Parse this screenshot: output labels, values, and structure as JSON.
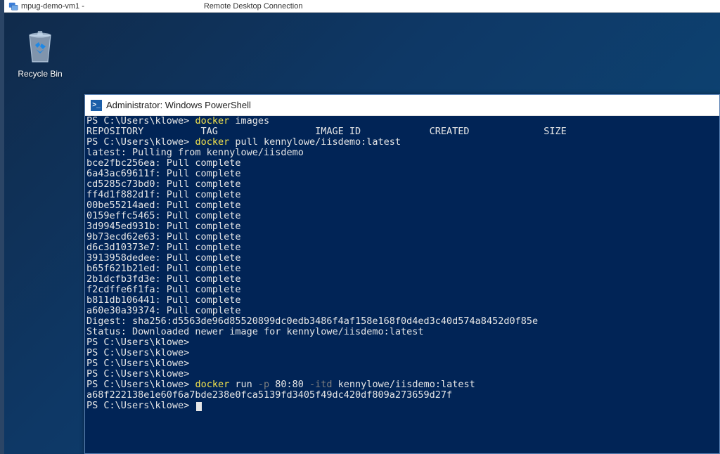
{
  "rdp": {
    "host": "mpug-demo-vm1 -",
    "title": "Remote Desktop Connection"
  },
  "desktop": {
    "recycle_bin_label": "Recycle Bin"
  },
  "powershell": {
    "title": "Administrator: Windows PowerShell",
    "prompt": "PS C:\\Users\\klowe>",
    "cmd1_a": "docker",
    "cmd1_b": " images",
    "header": "REPOSITORY          TAG                 IMAGE ID            CREATED             SIZE",
    "cmd2_a": "docker",
    "cmd2_b": " pull kennylowe/iisdemo:latest",
    "pull_status": "latest: Pulling from kennylowe/iisdemo",
    "layers": [
      "bce2fbc256ea: Pull complete",
      "6a43ac69611f: Pull complete",
      "cd5285c73bd0: Pull complete",
      "ff4d1f882d1f: Pull complete",
      "00be55214aed: Pull complete",
      "0159effc5465: Pull complete",
      "3d9945ed931b: Pull complete",
      "9b73ecd62e63: Pull complete",
      "d6c3d10373e7: Pull complete",
      "3913958dedee: Pull complete",
      "b65f621b21ed: Pull complete",
      "2b1dcfb3fd3e: Pull complete",
      "f2cdffe6f1fa: Pull complete",
      "b811db106441: Pull complete",
      "a60e30a39374: Pull complete"
    ],
    "digest": "Digest: sha256:d5563de96d85520899dc0edb3486f4af158e168f0d4ed3c40d574a8452d0f85e",
    "status": "Status: Downloaded newer image for kennylowe/iisdemo:latest",
    "cmd3_a": "docker",
    "cmd3_b": " run ",
    "cmd3_c": "-p",
    "cmd3_d": " 80:80 ",
    "cmd3_e": "-itd",
    "cmd3_f": " kennylowe/iisdemo:latest",
    "container_id": "a68f222138e1e60f6a7bde238e0fca5139fd3405f49dc420df809a273659d27f"
  }
}
